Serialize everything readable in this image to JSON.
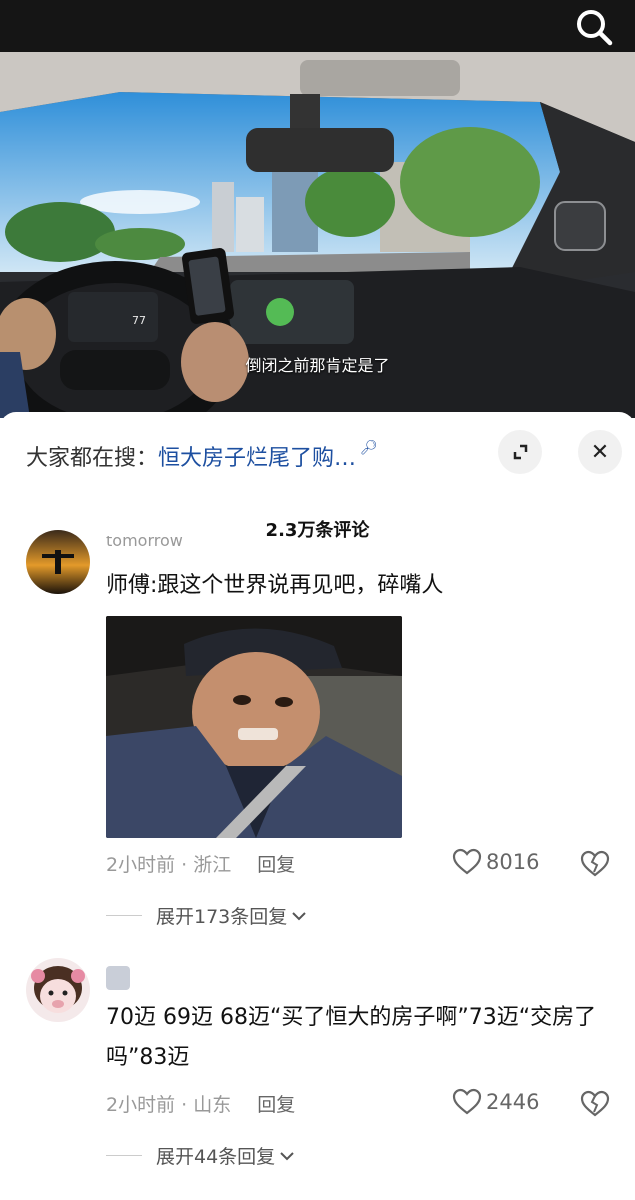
{
  "video": {
    "subtitle": "倒闭之前那肯定是了",
    "dash_reading": "77"
  },
  "hot_search": {
    "prefix": "大家都在搜：",
    "query": "恒大房子烂尾了购…",
    "query_icon": "search-small-icon"
  },
  "comments_header": {
    "count": "2.3万条评论"
  },
  "comments": [
    {
      "username": "tomorrow",
      "text": "师傅:跟这个世界说再见吧，碎嘴人",
      "time_location": "2小时前 · 浙江",
      "reply_label": "回复",
      "likes": "8016",
      "expand_label": "展开173条回复"
    },
    {
      "text": "70迈 69迈 68迈“买了恒大的房子啊”73迈“交房了吗”83迈",
      "time_location": "2小时前 · 山东",
      "reply_label": "回复",
      "likes": "2446",
      "expand_label": "展开44条回复"
    }
  ]
}
